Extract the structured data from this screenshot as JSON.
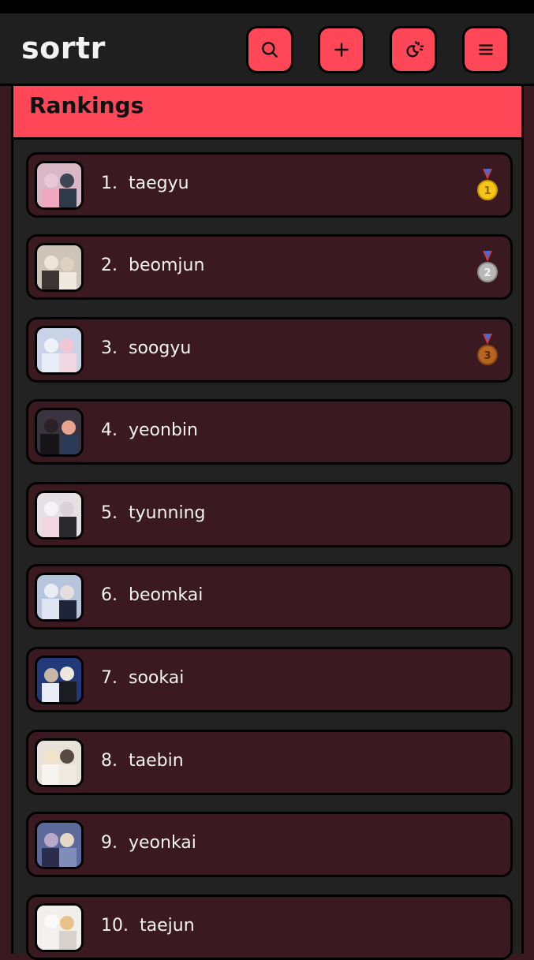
{
  "app": {
    "logo": "sortr"
  },
  "header": {
    "buttons": [
      {
        "icon": "search-icon"
      },
      {
        "icon": "plus-icon"
      },
      {
        "icon": "theme-toggle-icon"
      },
      {
        "icon": "menu-icon"
      }
    ]
  },
  "colors": {
    "accent": "#ff4757",
    "row_bg": "#3a1a20",
    "panel_bg": "#222222",
    "header_bg": "#1f1f1f",
    "gold": "#f5c518",
    "silver": "#b8b8b8",
    "bronze": "#b8651f"
  },
  "rankings": {
    "title": "Rankings",
    "items": [
      {
        "rank": "1.",
        "name": "taegyu",
        "medal": "gold-medal-icon",
        "medal_number": "1"
      },
      {
        "rank": "2.",
        "name": "beomjun",
        "medal": "silver-medal-icon",
        "medal_number": "2"
      },
      {
        "rank": "3.",
        "name": "soogyu",
        "medal": "bronze-medal-icon",
        "medal_number": "3"
      },
      {
        "rank": "4.",
        "name": "yeonbin"
      },
      {
        "rank": "5.",
        "name": "tyunning"
      },
      {
        "rank": "6.",
        "name": "beomkai"
      },
      {
        "rank": "7.",
        "name": "sookai"
      },
      {
        "rank": "8.",
        "name": "taebin"
      },
      {
        "rank": "9.",
        "name": "yeonkai"
      },
      {
        "rank": "10.",
        "name": "taejun"
      }
    ]
  }
}
